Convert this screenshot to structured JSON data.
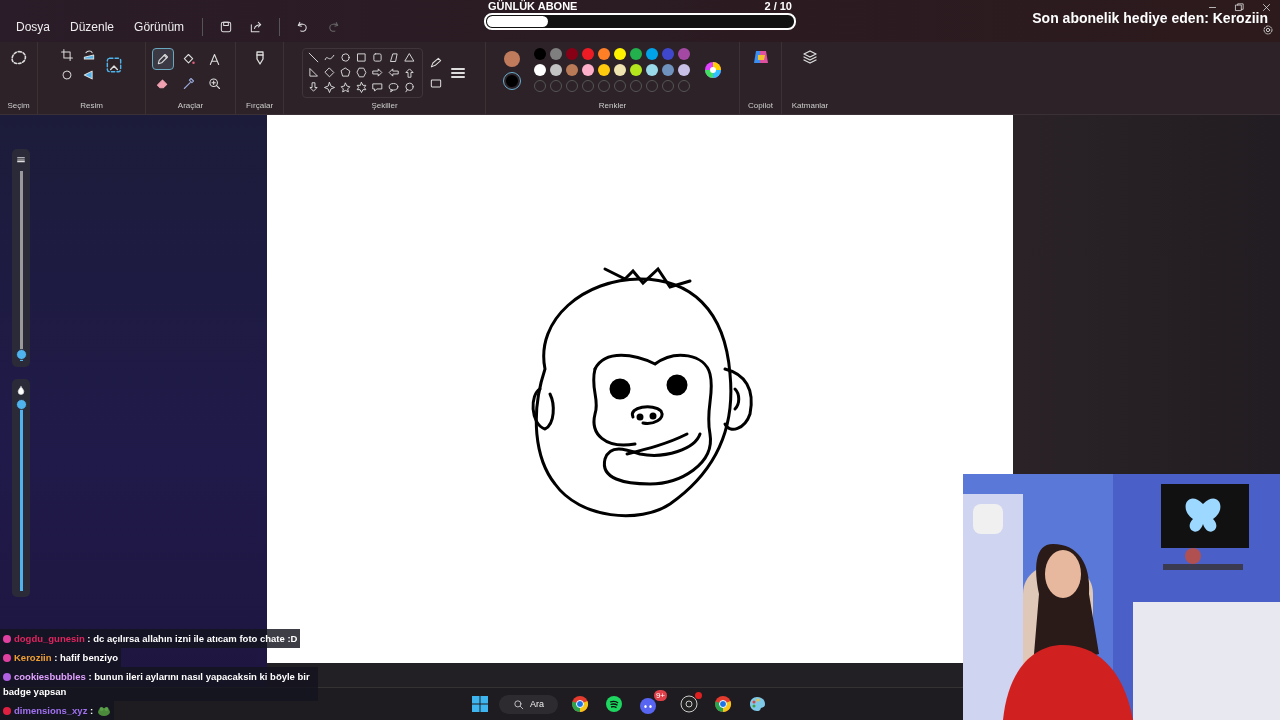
{
  "menu": [
    "Dosya",
    "Düzenle",
    "Görünüm"
  ],
  "subgoal": {
    "title": "GÜNLÜK ABONE",
    "count": "2  / 10",
    "level": 0.2
  },
  "last_gift": "Son abonelik hediye eden: Keroziin",
  "ribbon_groups": [
    "Seçim",
    "Resim",
    "Araçlar",
    "Fırçalar",
    "Şekiller",
    "Renkler",
    "Copilot",
    "Katmanlar"
  ],
  "tools": [
    {
      "selected": true
    },
    {
      "selected": false
    },
    {
      "selected": false
    },
    {
      "selected": false
    },
    {
      "selected": false
    },
    {
      "selected": false
    }
  ],
  "colors": {
    "current": [
      {
        "color": "#c07a5c"
      },
      {
        "color": "#000000"
      }
    ],
    "palette": [
      {
        "kind": "swatch",
        "color": "#000000"
      },
      {
        "kind": "swatch",
        "color": "#7f7f7f"
      },
      {
        "kind": "swatch",
        "color": "#880015"
      },
      {
        "kind": "swatch",
        "color": "#ed1c24"
      },
      {
        "kind": "swatch",
        "color": "#ff7f27"
      },
      {
        "kind": "swatch",
        "color": "#fff200"
      },
      {
        "kind": "swatch",
        "color": "#22b14c"
      },
      {
        "kind": "swatch",
        "color": "#00a2e8"
      },
      {
        "kind": "swatch",
        "color": "#3f48cc"
      },
      {
        "kind": "swatch",
        "color": "#a349a4"
      },
      {
        "kind": "swatch",
        "color": "#ffffff"
      },
      {
        "kind": "swatch",
        "color": "#c3c3c3"
      },
      {
        "kind": "swatch",
        "color": "#b97a57"
      },
      {
        "kind": "swatch",
        "color": "#ffaec9"
      },
      {
        "kind": "swatch",
        "color": "#ffc90e"
      },
      {
        "kind": "swatch",
        "color": "#efe4b0"
      },
      {
        "kind": "swatch",
        "color": "#b5e61d"
      },
      {
        "kind": "swatch",
        "color": "#99d9ea"
      },
      {
        "kind": "swatch",
        "color": "#7092be"
      },
      {
        "kind": "swatch",
        "color": "#c8bfe7"
      },
      {
        "kind": "empty"
      },
      {
        "kind": "empty"
      },
      {
        "kind": "empty"
      },
      {
        "kind": "empty"
      },
      {
        "kind": "empty"
      },
      {
        "kind": "empty"
      },
      {
        "kind": "empty"
      },
      {
        "kind": "empty"
      },
      {
        "kind": "empty"
      },
      {
        "kind": "empty"
      }
    ]
  },
  "sliders": [
    {
      "level": 0.03
    },
    {
      "level": 0.98
    }
  ],
  "chat": [
    {
      "user": "dogdu_gunesin",
      "color": "#e0245e",
      "badge": {
        "color": "#e040a0"
      },
      "text": ": dc açılırsa allahın izni ile atıcam foto chate :D"
    },
    {
      "user": "Keroziin",
      "color": "#f0a030",
      "badge": {
        "color": "#e040a0"
      },
      "text": ": hafif benziyo"
    },
    {
      "user": "cookiesbubbles",
      "color": "#e0a0ff",
      "badge": {
        "color": "#b060e0"
      },
      "text": ": bunun ileri aylarını nasıl yapacaksin ki böyle bir badge yapsan"
    },
    {
      "user": "dimensions_xyz",
      "color": "#a070f0",
      "badge": {
        "color": "#e02040"
      },
      "text": ":"
    }
  ],
  "taskbar": {
    "search": "Ara",
    "discord_badge": "9+"
  }
}
